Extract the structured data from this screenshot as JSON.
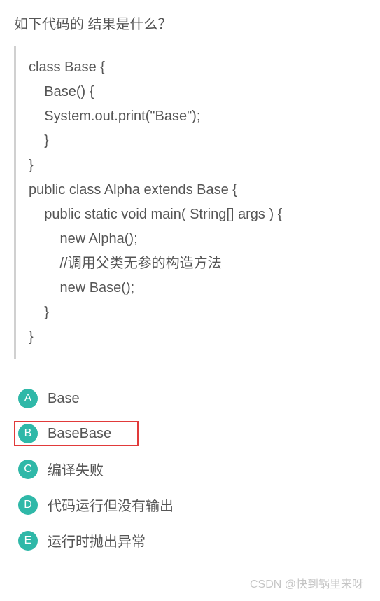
{
  "question": "如下代码的 结果是什么？",
  "code_lines": [
    "class Base {",
    "    Base() {",
    "    System.out.print(\"Base\");",
    "    }",
    "}",
    "public class Alpha extends Base {",
    "    public static void main( String[] args ) {",
    "        new Alpha();",
    "        //调用父类无参的构造方法",
    "        new Base();",
    "    }",
    "}"
  ],
  "options": [
    {
      "letter": "A",
      "text": "Base",
      "selected": false
    },
    {
      "letter": "B",
      "text": "BaseBase",
      "selected": true
    },
    {
      "letter": "C",
      "text": "编译失败",
      "selected": false
    },
    {
      "letter": "D",
      "text": "代码运行但没有输出",
      "selected": false
    },
    {
      "letter": "E",
      "text": "运行时抛出异常",
      "selected": false
    }
  ],
  "watermark": "CSDN @快到锅里来呀"
}
